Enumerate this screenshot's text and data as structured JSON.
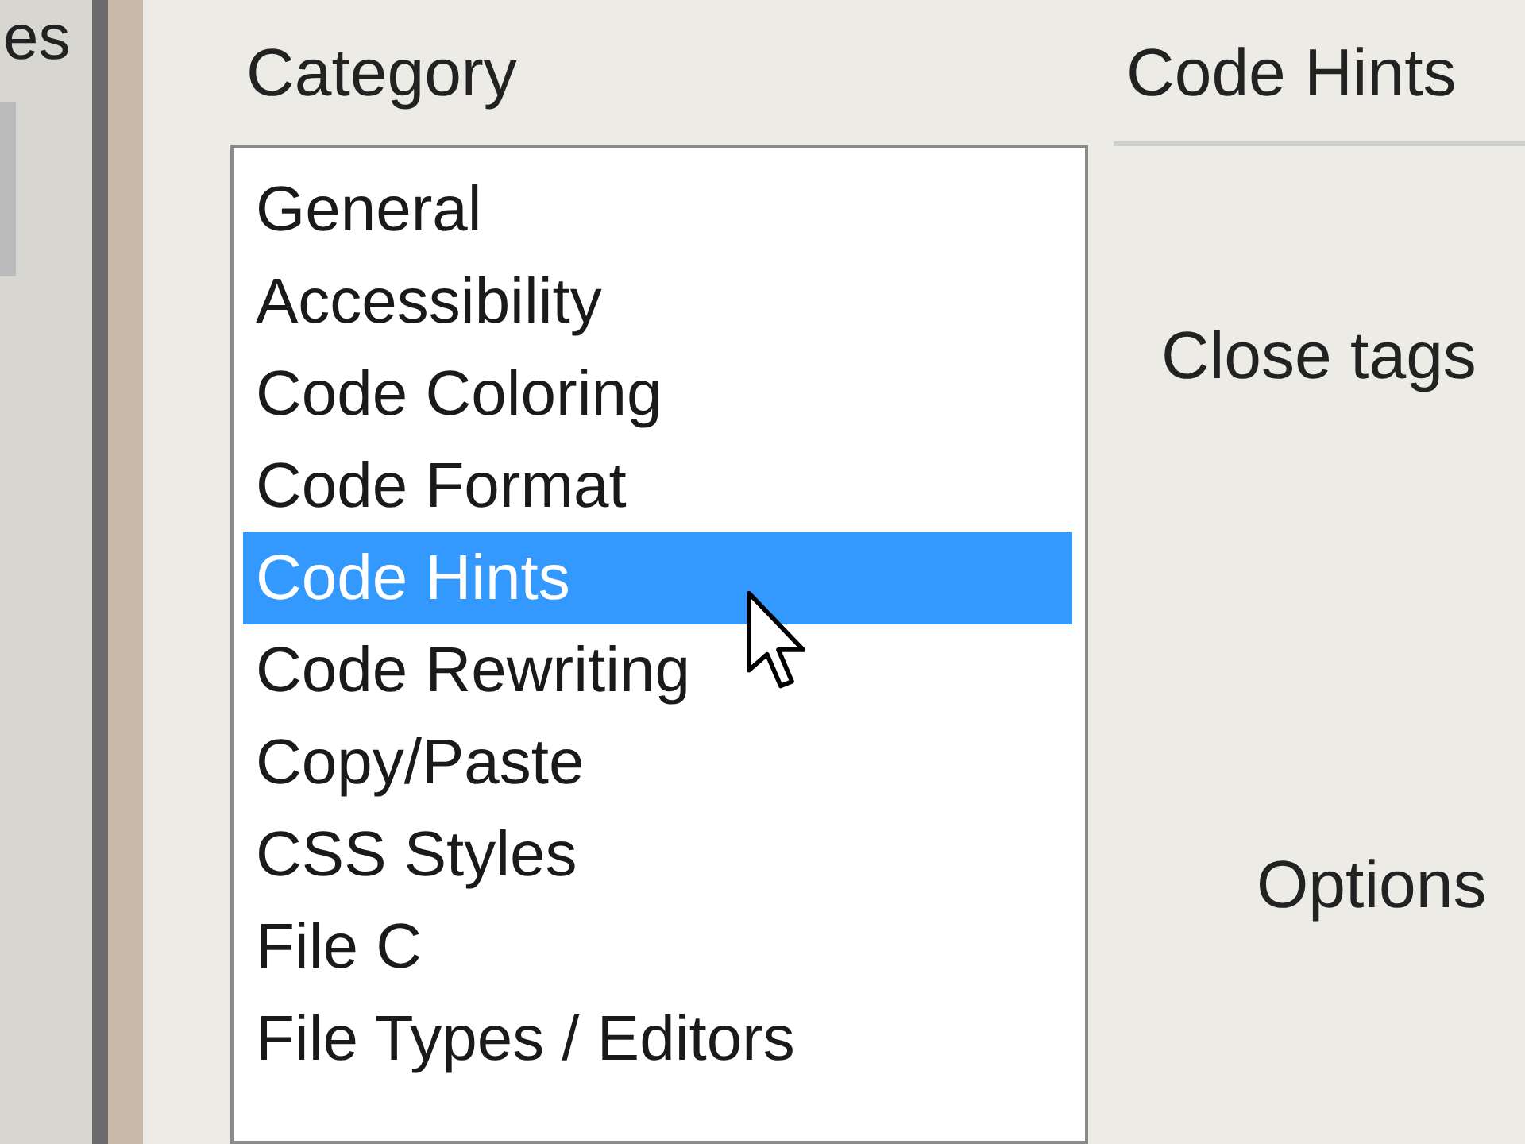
{
  "background_window": {
    "text": "es"
  },
  "category": {
    "label": "Category",
    "items": [
      {
        "label": "General",
        "selected": false
      },
      {
        "label": "Accessibility",
        "selected": false
      },
      {
        "label": "Code Coloring",
        "selected": false
      },
      {
        "label": "Code Format",
        "selected": false
      },
      {
        "label": "Code Hints",
        "selected": true
      },
      {
        "label": "Code Rewriting",
        "selected": false
      },
      {
        "label": "Copy/Paste",
        "selected": false
      },
      {
        "label": "CSS Styles",
        "selected": false
      },
      {
        "label": "File C",
        "selected": false
      },
      {
        "label": "File Types / Editors",
        "selected": false
      }
    ]
  },
  "panel": {
    "title": "Code Hints",
    "close_tags_label": "Close tags",
    "options_label": "Options"
  }
}
